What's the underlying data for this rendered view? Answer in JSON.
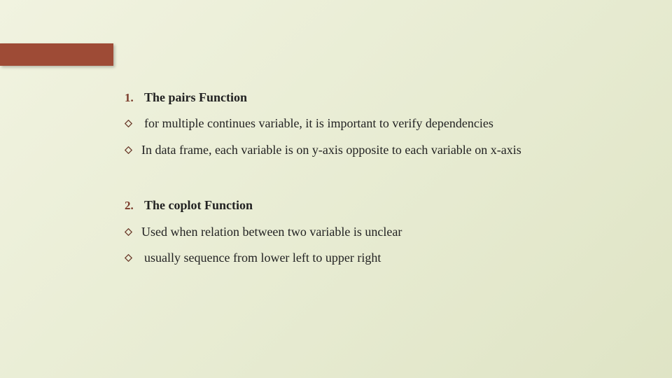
{
  "accent_color": "#9e4b36",
  "sections": [
    {
      "number": "1.",
      "title": "The pairs Function",
      "bullets": [
        "for multiple continues variable, it is important to verify dependencies",
        "In data frame, each variable is on y-axis opposite to each variable on x-axis"
      ]
    },
    {
      "number": "2.",
      "title": "The coplot Function",
      "bullets": [
        "Used when relation between two variable is unclear",
        "usually sequence from lower left to upper right"
      ]
    }
  ]
}
